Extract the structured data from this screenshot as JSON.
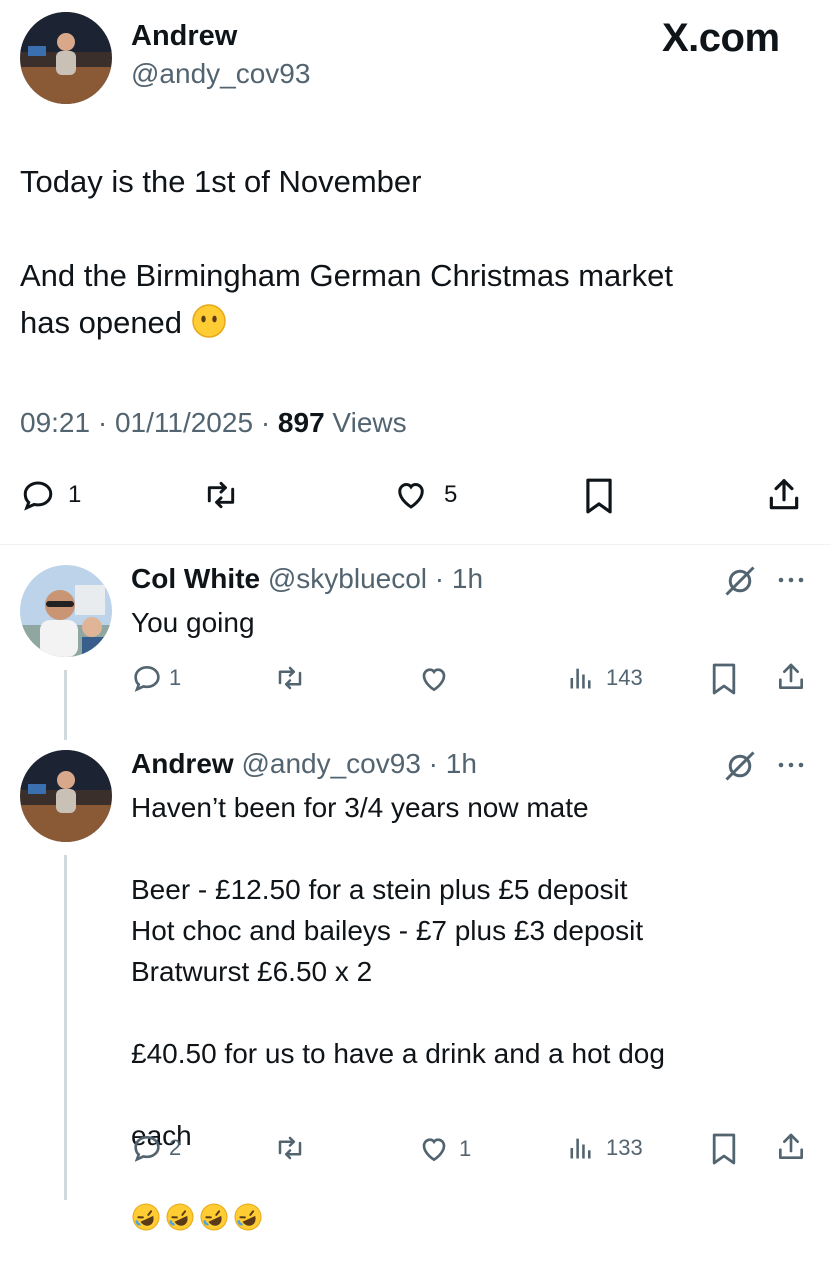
{
  "branding": {
    "site": "X.com"
  },
  "main_post": {
    "author_name": "Andrew",
    "handle": "@andy_cov93",
    "text_line1": "Today is the 1st of November",
    "text_line2": "And the Birmingham German Christmas market",
    "text_line3": "has opened",
    "time": "09:21",
    "date": "01/11/2025",
    "views_count": "897",
    "views_label": "Views",
    "stats": {
      "replies": "1",
      "likes": "5"
    }
  },
  "replies": [
    {
      "author_name": "Col White",
      "handle": "@skybluecol",
      "time_ago": "1h",
      "text": "You going",
      "stats": {
        "replies": "1",
        "views": "143"
      }
    },
    {
      "author_name": "Andrew",
      "handle": "@andy_cov93",
      "time_ago": "1h",
      "text": "Haven’t been for 3/4 years now mate\n\nBeer - £12.50 for a stein plus £5 deposit\nHot choc and baileys - £7 plus £3 deposit\nBratwurst £6.50 x 2\n\n£40.50 for us to have a drink and a hot dog",
      "text_last": "each",
      "stats": {
        "replies": "2",
        "likes": "1",
        "views": "133"
      }
    }
  ],
  "colors": {
    "text": "#0f1419",
    "muted": "#536471",
    "divider": "#eff3f4",
    "thread_line": "#cfd9de"
  },
  "icons": [
    "reply-icon",
    "repost-icon",
    "like-icon",
    "bookmark-icon",
    "share-icon",
    "views-icon",
    "grok-icon",
    "more-icon"
  ]
}
